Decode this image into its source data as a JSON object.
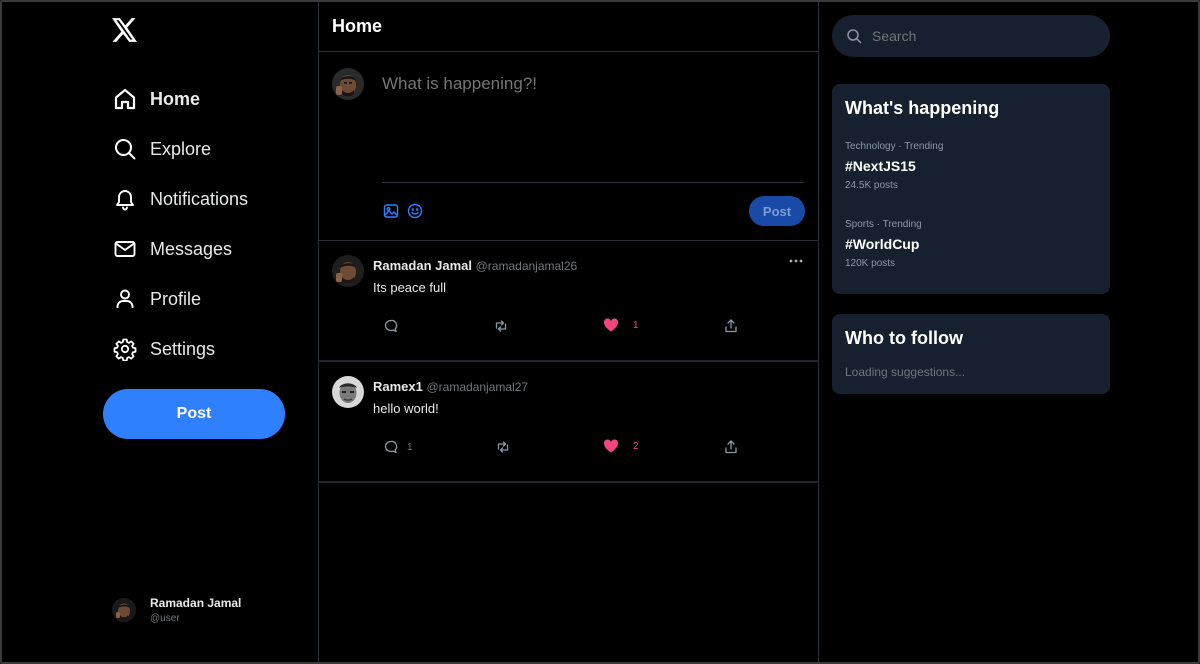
{
  "brand": {
    "logo_icon": "x-logo-icon"
  },
  "nav": {
    "items": [
      {
        "label": "Home",
        "icon": "home-icon",
        "active": true
      },
      {
        "label": "Explore",
        "icon": "search-icon",
        "active": false
      },
      {
        "label": "Notifications",
        "icon": "bell-icon",
        "active": false
      },
      {
        "label": "Messages",
        "icon": "mail-icon",
        "active": false
      },
      {
        "label": "Profile",
        "icon": "user-icon",
        "active": false
      },
      {
        "label": "Settings",
        "icon": "gear-icon",
        "active": false
      }
    ],
    "post_label": "Post"
  },
  "current_user": {
    "name": "Ramadan Jamal",
    "handle": "@user"
  },
  "main": {
    "title": "Home",
    "composer": {
      "placeholder": "What is happening?!",
      "post_label": "Post"
    },
    "tweets": [
      {
        "name": "Ramadan Jamal",
        "handle": "@ramadanjamal26",
        "text": "Its peace full",
        "replies": "",
        "likes": "1"
      },
      {
        "name": "Ramex1",
        "handle": "@ramadanjamal27",
        "text": "hello world!",
        "replies": "1",
        "likes": "2"
      }
    ]
  },
  "right": {
    "search_placeholder": "Search",
    "happening": {
      "title": "What's happening",
      "trends": [
        {
          "meta": "Technology · Trending",
          "tag": "#NextJS15",
          "count": "24.5K posts"
        },
        {
          "meta": "Sports · Trending",
          "tag": "#WorldCup",
          "count": "120K posts"
        }
      ]
    },
    "follow": {
      "title": "Who to follow",
      "status": "Loading suggestions..."
    }
  },
  "colors": {
    "accent": "#2f80ff",
    "like": "#f0457f",
    "panel": "#16202e",
    "background": "#000000"
  }
}
